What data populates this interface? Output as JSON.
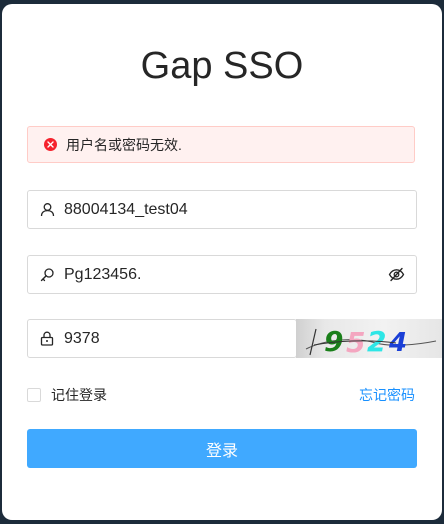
{
  "title": "Gap SSO",
  "alert": {
    "message": "用户名或密码无效.",
    "icon": "close-circle-icon",
    "color": "#f5222d"
  },
  "username": {
    "icon": "user-icon",
    "value": "88004134_test04"
  },
  "password": {
    "icon": "key-icon",
    "value": "Pg123456.",
    "toggle_icon": "eye-invisible-icon"
  },
  "captcha": {
    "icon": "lock-icon",
    "value": "9378",
    "image_text": "9524",
    "image_chars": [
      {
        "char": "9",
        "color": "#1a7f1a"
      },
      {
        "char": "5",
        "color": "#f4a6c0"
      },
      {
        "char": "2",
        "color": "#2ee6e6"
      },
      {
        "char": "4",
        "color": "#1a3fd6"
      }
    ]
  },
  "remember": {
    "label": "记住登录",
    "checked": false
  },
  "forgot_password": "忘记密码",
  "login_button": "登录",
  "colors": {
    "primary": "#40a9ff",
    "link": "#1890ff",
    "alert_bg": "#fff1f0",
    "alert_border": "#ffccc7"
  }
}
